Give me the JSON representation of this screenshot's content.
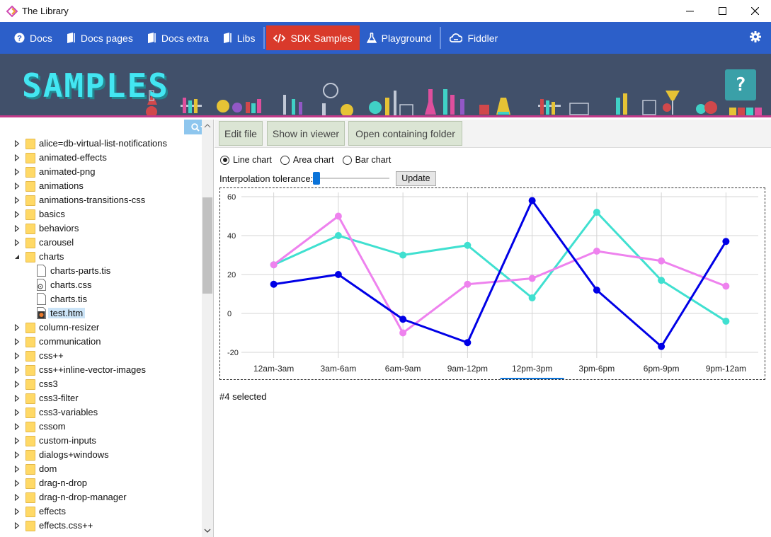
{
  "window": {
    "title": "The Library",
    "controls": [
      "minimize",
      "maximize",
      "close"
    ]
  },
  "toolbar": {
    "items": [
      {
        "label": "Docs",
        "icon": "question-circle-icon",
        "active": false
      },
      {
        "label": "Docs pages",
        "icon": "book-icon",
        "active": false
      },
      {
        "label": "Docs extra",
        "icon": "book-icon",
        "active": false
      },
      {
        "label": "Libs",
        "icon": "book-icon",
        "active": false
      },
      {
        "label": "SDK Samples",
        "icon": "code-icon",
        "active": true
      },
      {
        "label": "Playground",
        "icon": "flask-icon",
        "active": false
      },
      {
        "label": "Fiddler",
        "icon": "cloud-icon",
        "active": false
      }
    ],
    "active_color": "#d93a2b",
    "bar_color": "#2c5fc9"
  },
  "banner": {
    "title": "SAMPLES",
    "help_label": "?"
  },
  "tree": {
    "items": [
      {
        "label": "alice=db-virtual-list-notifications",
        "type": "folder",
        "expanded": false
      },
      {
        "label": "animated-effects",
        "type": "folder",
        "expanded": false
      },
      {
        "label": "animated-png",
        "type": "folder",
        "expanded": false
      },
      {
        "label": "animations",
        "type": "folder",
        "expanded": false
      },
      {
        "label": "animations-transitions-css",
        "type": "folder",
        "expanded": false
      },
      {
        "label": "basics",
        "type": "folder",
        "expanded": false
      },
      {
        "label": "behaviors",
        "type": "folder",
        "expanded": false
      },
      {
        "label": "carousel",
        "type": "folder",
        "expanded": false
      },
      {
        "label": "charts",
        "type": "folder",
        "expanded": true
      },
      {
        "label": "charts-parts.tis",
        "type": "file",
        "child": true
      },
      {
        "label": "charts.css",
        "type": "css-file",
        "child": true
      },
      {
        "label": "charts.tis",
        "type": "file",
        "child": true
      },
      {
        "label": "test.htm",
        "type": "htm-file",
        "child": true,
        "selected": true
      },
      {
        "label": "column-resizer",
        "type": "folder",
        "expanded": false
      },
      {
        "label": "communication",
        "type": "folder",
        "expanded": false
      },
      {
        "label": "css++",
        "type": "folder",
        "expanded": false
      },
      {
        "label": "css++inline-vector-images",
        "type": "folder",
        "expanded": false
      },
      {
        "label": "css3",
        "type": "folder",
        "expanded": false
      },
      {
        "label": "css3-filter",
        "type": "folder",
        "expanded": false
      },
      {
        "label": "css3-variables",
        "type": "folder",
        "expanded": false
      },
      {
        "label": "cssom",
        "type": "folder",
        "expanded": false
      },
      {
        "label": "custom-inputs",
        "type": "folder",
        "expanded": false
      },
      {
        "label": "dialogs+windows",
        "type": "folder",
        "expanded": false
      },
      {
        "label": "dom",
        "type": "folder",
        "expanded": false
      },
      {
        "label": "drag-n-drop",
        "type": "folder",
        "expanded": false
      },
      {
        "label": "drag-n-drop-manager",
        "type": "folder",
        "expanded": false
      },
      {
        "label": "effects",
        "type": "folder",
        "expanded": false
      },
      {
        "label": "effects.css++",
        "type": "folder",
        "expanded": false
      }
    ]
  },
  "actions": {
    "edit_file": "Edit file",
    "show_in_viewer": "Show in viewer",
    "open_folder": "Open containing folder"
  },
  "controls": {
    "chart_types": [
      {
        "label": "Line chart",
        "checked": true
      },
      {
        "label": "Area chart",
        "checked": false
      },
      {
        "label": "Bar chart",
        "checked": false
      }
    ],
    "interpolation_label": "Interpolation tolerance:",
    "interpolation_value": 0,
    "update_label": "Update"
  },
  "chart_data": {
    "type": "line",
    "categories": [
      "12am-3am",
      "3am-6am",
      "6am-9am",
      "9am-12pm",
      "12pm-3pm",
      "3pm-6pm",
      "6pm-9pm",
      "9pm-12am"
    ],
    "series": [
      {
        "color": "#40e0d0",
        "values": [
          25,
          40,
          30,
          35,
          8,
          52,
          17,
          -4
        ]
      },
      {
        "color": "#ee82ee",
        "values": [
          25,
          50,
          -10,
          15,
          18,
          32,
          27,
          14
        ]
      },
      {
        "color": "#0000e6",
        "values": [
          15,
          20,
          -3,
          -15,
          58,
          12,
          -17,
          37
        ]
      }
    ],
    "ylim": [
      -20,
      60
    ],
    "yticks": [
      -20,
      0,
      20,
      40,
      60
    ],
    "grid": true,
    "selected_index": 4,
    "selected_color": "#0a73d9"
  },
  "status": {
    "text": "#4 selected"
  }
}
